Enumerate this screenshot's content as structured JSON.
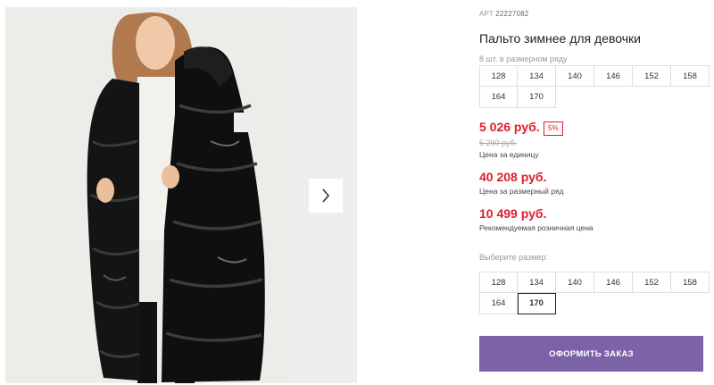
{
  "product": {
    "article_label": "АРТ",
    "article_code": "22227082",
    "title": "Пальто зимнее для девочки"
  },
  "pack": {
    "label": "8 шт. в размерном ряду",
    "sizes": [
      "128",
      "134",
      "140",
      "146",
      "152",
      "158",
      "164",
      "170"
    ]
  },
  "prices": {
    "unit_price": "5 026 руб.",
    "discount": "5%",
    "old_price": "5 290 руб.",
    "unit_label": "Цена за единицу",
    "pack_price": "40 208 руб.",
    "pack_label": "Цена за размерный ряд",
    "retail_price": "10 499 руб.",
    "retail_label": "Рекомендуемая розничная цена"
  },
  "size_picker": {
    "label": "Выберите размер:",
    "sizes": [
      "128",
      "134",
      "140",
      "146",
      "152",
      "158",
      "164",
      "170"
    ],
    "selected": "170"
  },
  "order_button": "ОФОРМИТЬ ЗАКАЗ",
  "gallery": {
    "next_icon": "chevron-right-icon"
  },
  "colors": {
    "price_red": "#e01d2c",
    "button_purple": "#7c63a8"
  }
}
